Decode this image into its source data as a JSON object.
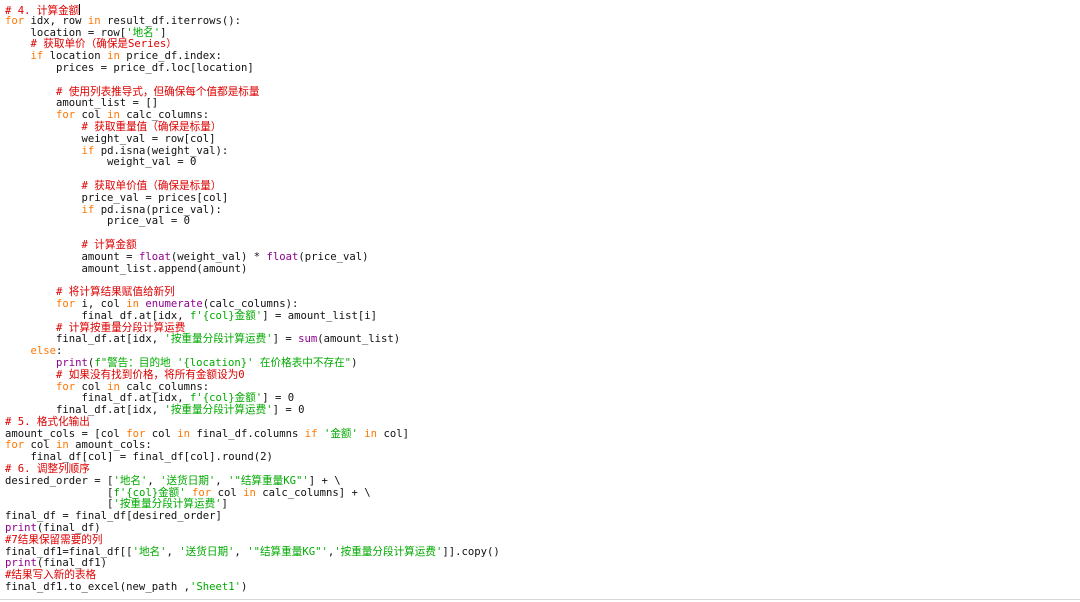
{
  "editor": {
    "lines": [
      [
        {
          "t": "cm",
          "v": "# 4. 计算金额"
        }
      ],
      [
        {
          "t": "kw",
          "v": "for"
        },
        {
          "t": "id",
          "v": " idx, row "
        },
        {
          "t": "kw",
          "v": "in"
        },
        {
          "t": "id",
          "v": " result_df.iterrows():"
        }
      ],
      [
        {
          "t": "id",
          "v": "    location = row["
        },
        {
          "t": "str",
          "v": "'地名'"
        },
        {
          "t": "id",
          "v": "]"
        }
      ],
      [
        {
          "t": "id",
          "v": "    "
        },
        {
          "t": "cm",
          "v": "# 获取单价（确保是Series）"
        }
      ],
      [
        {
          "t": "id",
          "v": "    "
        },
        {
          "t": "kw",
          "v": "if"
        },
        {
          "t": "id",
          "v": " location "
        },
        {
          "t": "kw",
          "v": "in"
        },
        {
          "t": "id",
          "v": " price_df.index:"
        }
      ],
      [
        {
          "t": "id",
          "v": "        prices = price_df.loc[location]"
        }
      ],
      [
        {
          "t": "id",
          "v": ""
        }
      ],
      [
        {
          "t": "id",
          "v": "        "
        },
        {
          "t": "cm",
          "v": "# 使用列表推导式，但确保每个值都是标量"
        }
      ],
      [
        {
          "t": "id",
          "v": "        amount_list = []"
        }
      ],
      [
        {
          "t": "id",
          "v": "        "
        },
        {
          "t": "kw",
          "v": "for"
        },
        {
          "t": "id",
          "v": " col "
        },
        {
          "t": "kw",
          "v": "in"
        },
        {
          "t": "id",
          "v": " calc_columns:"
        }
      ],
      [
        {
          "t": "id",
          "v": "            "
        },
        {
          "t": "cm",
          "v": "# 获取重量值（确保是标量）"
        }
      ],
      [
        {
          "t": "id",
          "v": "            weight_val = row[col]"
        }
      ],
      [
        {
          "t": "id",
          "v": "            "
        },
        {
          "t": "kw",
          "v": "if"
        },
        {
          "t": "id",
          "v": " pd.isna(weight_val):"
        }
      ],
      [
        {
          "t": "id",
          "v": "                weight_val = 0"
        }
      ],
      [
        {
          "t": "id",
          "v": ""
        }
      ],
      [
        {
          "t": "id",
          "v": "            "
        },
        {
          "t": "cm",
          "v": "# 获取单价值（确保是标量）"
        }
      ],
      [
        {
          "t": "id",
          "v": "            price_val = prices[col]"
        }
      ],
      [
        {
          "t": "id",
          "v": "            "
        },
        {
          "t": "kw",
          "v": "if"
        },
        {
          "t": "id",
          "v": " pd.isna(price_val):"
        }
      ],
      [
        {
          "t": "id",
          "v": "                price_val = 0"
        }
      ],
      [
        {
          "t": "id",
          "v": ""
        }
      ],
      [
        {
          "t": "id",
          "v": "            "
        },
        {
          "t": "cm",
          "v": "# 计算金额"
        }
      ],
      [
        {
          "t": "id",
          "v": "            amount = "
        },
        {
          "t": "bi",
          "v": "float"
        },
        {
          "t": "id",
          "v": "(weight_val) * "
        },
        {
          "t": "bi",
          "v": "float"
        },
        {
          "t": "id",
          "v": "(price_val)"
        }
      ],
      [
        {
          "t": "id",
          "v": "            amount_list.append(amount)"
        }
      ],
      [
        {
          "t": "id",
          "v": ""
        }
      ],
      [
        {
          "t": "id",
          "v": "        "
        },
        {
          "t": "cm",
          "v": "# 将计算结果赋值给新列"
        }
      ],
      [
        {
          "t": "id",
          "v": "        "
        },
        {
          "t": "kw",
          "v": "for"
        },
        {
          "t": "id",
          "v": " i, col "
        },
        {
          "t": "kw",
          "v": "in"
        },
        {
          "t": "id",
          "v": " "
        },
        {
          "t": "bi",
          "v": "enumerate"
        },
        {
          "t": "id",
          "v": "(calc_columns):"
        }
      ],
      [
        {
          "t": "id",
          "v": "            final_df.at[idx, "
        },
        {
          "t": "str",
          "v": "f'{col}金额'"
        },
        {
          "t": "id",
          "v": "] = amount_list[i]"
        }
      ],
      [
        {
          "t": "id",
          "v": "        "
        },
        {
          "t": "cm",
          "v": "# 计算按重量分段计算运费"
        }
      ],
      [
        {
          "t": "id",
          "v": "        final_df.at[idx, "
        },
        {
          "t": "str",
          "v": "'按重量分段计算运费'"
        },
        {
          "t": "id",
          "v": "] = "
        },
        {
          "t": "bi",
          "v": "sum"
        },
        {
          "t": "id",
          "v": "(amount_list)"
        }
      ],
      [
        {
          "t": "id",
          "v": "    "
        },
        {
          "t": "kw",
          "v": "else"
        },
        {
          "t": "id",
          "v": ":"
        }
      ],
      [
        {
          "t": "id",
          "v": "        "
        },
        {
          "t": "bi",
          "v": "print"
        },
        {
          "t": "id",
          "v": "("
        },
        {
          "t": "str",
          "v": "f\"警告：目的地 '{location}' 在价格表中不存在\""
        },
        {
          "t": "id",
          "v": ")"
        }
      ],
      [
        {
          "t": "id",
          "v": "        "
        },
        {
          "t": "cm",
          "v": "# 如果没有找到价格，将所有金额设为0"
        }
      ],
      [
        {
          "t": "id",
          "v": "        "
        },
        {
          "t": "kw",
          "v": "for"
        },
        {
          "t": "id",
          "v": " col "
        },
        {
          "t": "kw",
          "v": "in"
        },
        {
          "t": "id",
          "v": " calc_columns:"
        }
      ],
      [
        {
          "t": "id",
          "v": "            final_df.at[idx, "
        },
        {
          "t": "str",
          "v": "f'{col}金额'"
        },
        {
          "t": "id",
          "v": "] = 0"
        }
      ],
      [
        {
          "t": "id",
          "v": "        final_df.at[idx, "
        },
        {
          "t": "str",
          "v": "'按重量分段计算运费'"
        },
        {
          "t": "id",
          "v": "] = 0"
        }
      ],
      [
        {
          "t": "cm",
          "v": "# 5. 格式化输出"
        }
      ],
      [
        {
          "t": "id",
          "v": "amount_cols = [col "
        },
        {
          "t": "kw",
          "v": "for"
        },
        {
          "t": "id",
          "v": " col "
        },
        {
          "t": "kw",
          "v": "in"
        },
        {
          "t": "id",
          "v": " final_df.columns "
        },
        {
          "t": "kw",
          "v": "if"
        },
        {
          "t": "id",
          "v": " "
        },
        {
          "t": "str",
          "v": "'金额'"
        },
        {
          "t": "id",
          "v": " "
        },
        {
          "t": "kw",
          "v": "in"
        },
        {
          "t": "id",
          "v": " col]"
        }
      ],
      [
        {
          "t": "kw",
          "v": "for"
        },
        {
          "t": "id",
          "v": " col "
        },
        {
          "t": "kw",
          "v": "in"
        },
        {
          "t": "id",
          "v": " amount_cols:"
        }
      ],
      [
        {
          "t": "id",
          "v": "    final_df[col] = final_df[col].round(2)"
        }
      ],
      [
        {
          "t": "cm",
          "v": "# 6. 调整列顺序"
        }
      ],
      [
        {
          "t": "id",
          "v": "desired_order = ["
        },
        {
          "t": "str",
          "v": "'地名'"
        },
        {
          "t": "id",
          "v": ", "
        },
        {
          "t": "str",
          "v": "'送货日期'"
        },
        {
          "t": "id",
          "v": ", "
        },
        {
          "t": "str",
          "v": "'\"结算重量KG\"'"
        },
        {
          "t": "id",
          "v": "] + \\"
        }
      ],
      [
        {
          "t": "id",
          "v": "                ["
        },
        {
          "t": "str",
          "v": "f'{col}金额'"
        },
        {
          "t": "id",
          "v": " "
        },
        {
          "t": "kw",
          "v": "for"
        },
        {
          "t": "id",
          "v": " col "
        },
        {
          "t": "kw",
          "v": "in"
        },
        {
          "t": "id",
          "v": " calc_columns] + \\"
        }
      ],
      [
        {
          "t": "id",
          "v": "                ["
        },
        {
          "t": "str",
          "v": "'按重量分段计算运费'"
        },
        {
          "t": "id",
          "v": "]"
        }
      ],
      [
        {
          "t": "id",
          "v": "final_df = final_df[desired_order]"
        }
      ],
      [
        {
          "t": "bi",
          "v": "print"
        },
        {
          "t": "id",
          "v": "(final_df)"
        }
      ],
      [
        {
          "t": "cm",
          "v": "#7结果保留需要的列"
        }
      ],
      [
        {
          "t": "id",
          "v": "final_df1=final_df[["
        },
        {
          "t": "str",
          "v": "'地名'"
        },
        {
          "t": "id",
          "v": ", "
        },
        {
          "t": "str",
          "v": "'送货日期'"
        },
        {
          "t": "id",
          "v": ", "
        },
        {
          "t": "str",
          "v": "'\"结算重量KG\"'"
        },
        {
          "t": "id",
          "v": ","
        },
        {
          "t": "str",
          "v": "'按重量分段计算运费'"
        },
        {
          "t": "id",
          "v": "]].copy()"
        }
      ],
      [
        {
          "t": "bi",
          "v": "print"
        },
        {
          "t": "id",
          "v": "(final_df1)"
        }
      ],
      [
        {
          "t": "cm",
          "v": "#结果写入新的表格"
        }
      ],
      [
        {
          "t": "id",
          "v": "final_df1.to_excel(new_path ,"
        },
        {
          "t": "str",
          "v": "'Sheet1'"
        },
        {
          "t": "id",
          "v": ")"
        }
      ]
    ]
  },
  "colors": {
    "keyword": "#ff7700",
    "builtin": "#900090",
    "string": "#00aa00",
    "comment": "#dd0000",
    "text": "#111111",
    "background": "#ffffff"
  }
}
